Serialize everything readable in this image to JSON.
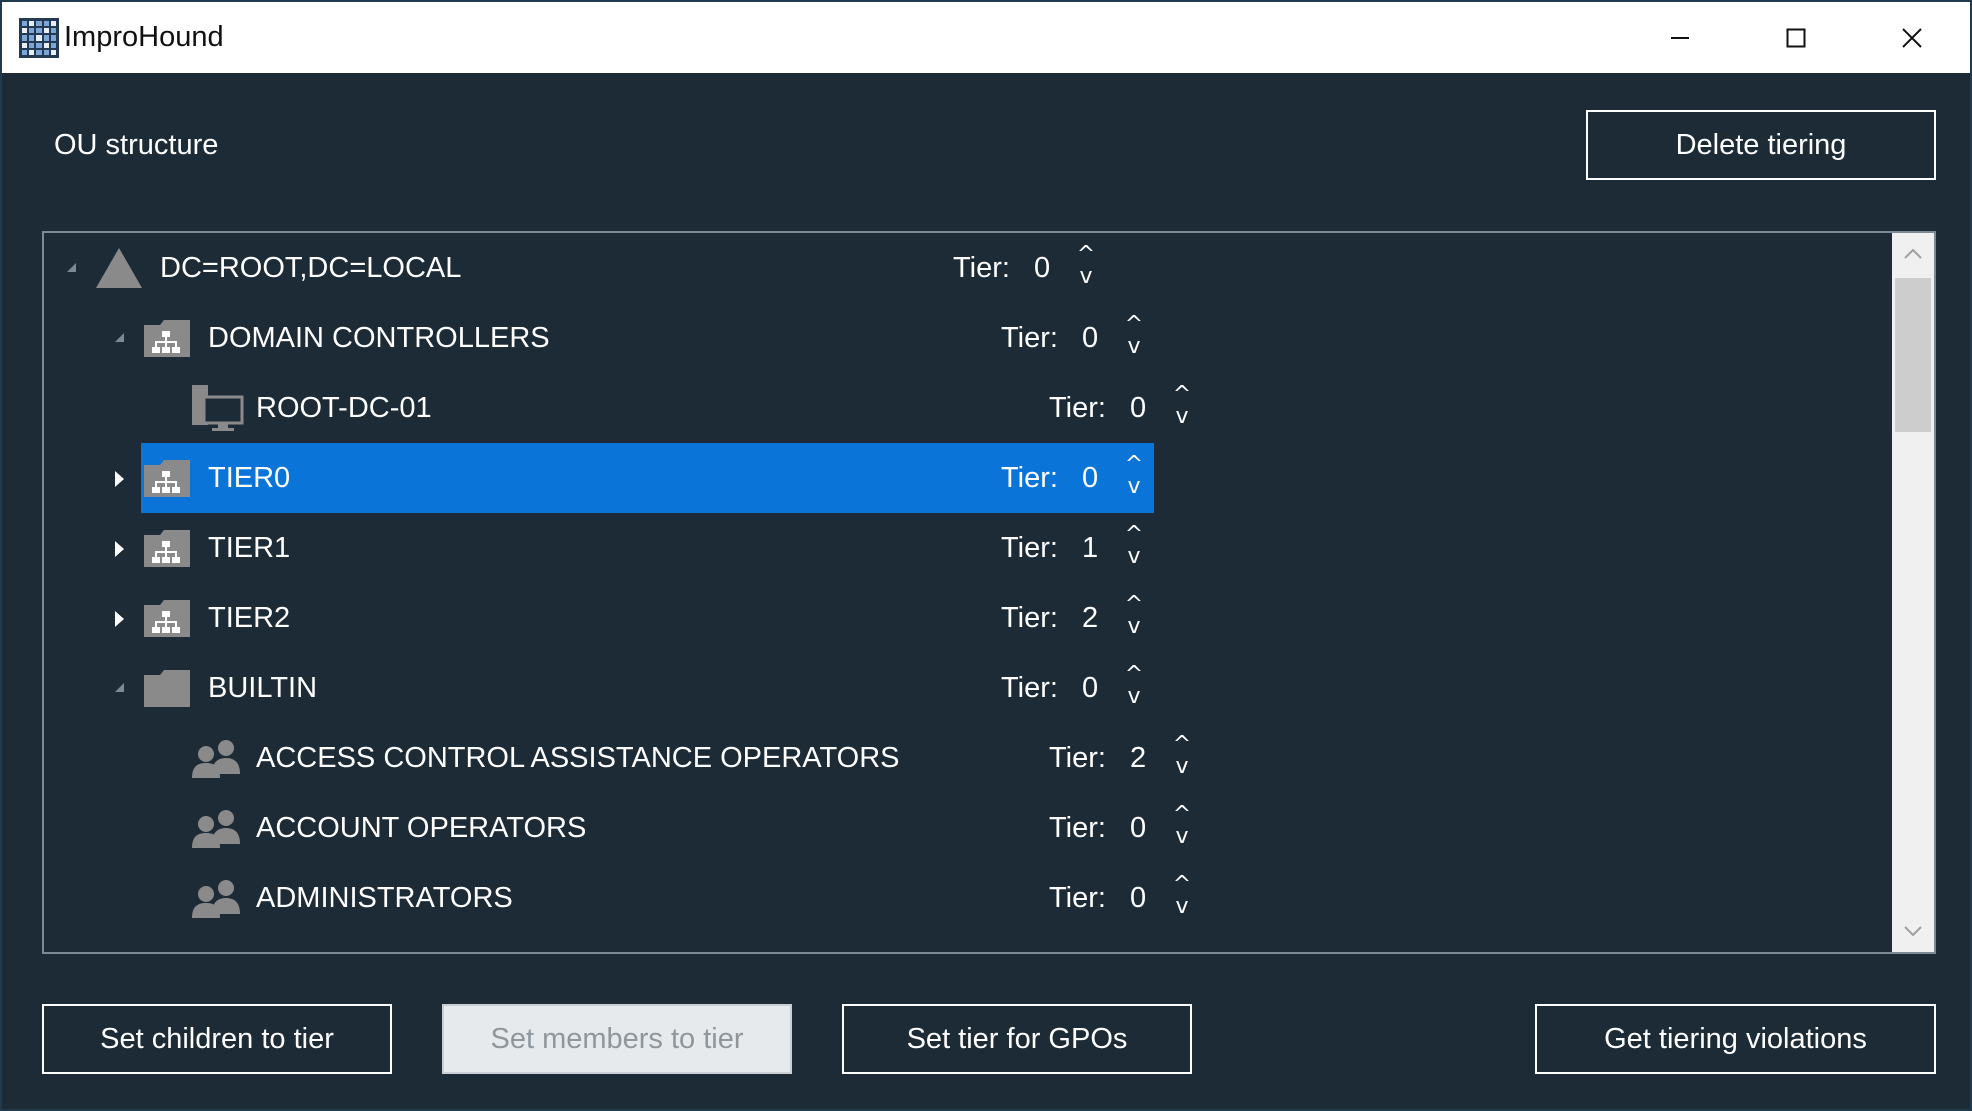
{
  "window": {
    "title": "ImproHound",
    "controls": {
      "minimize": "minimize-icon",
      "maximize": "maximize-icon",
      "close": "close-icon"
    }
  },
  "header": {
    "section_label": "OU structure",
    "delete_button": "Delete tiering"
  },
  "tree": {
    "tier_prefix": "Tier:",
    "rows": [
      {
        "label": "DC=ROOT,DC=LOCAL",
        "icon": "domain-icon",
        "tier": "0",
        "expanded": true,
        "selected": false
      },
      {
        "label": "DOMAIN CONTROLLERS",
        "icon": "ou-icon",
        "tier": "0",
        "expanded": true,
        "selected": false
      },
      {
        "label": "ROOT-DC-01",
        "icon": "computer-icon",
        "tier": "0",
        "expanded": null,
        "selected": false
      },
      {
        "label": "TIER0",
        "icon": "ou-icon",
        "tier": "0",
        "expanded": false,
        "selected": true
      },
      {
        "label": "TIER1",
        "icon": "ou-icon",
        "tier": "1",
        "expanded": false,
        "selected": false
      },
      {
        "label": "TIER2",
        "icon": "ou-icon",
        "tier": "2",
        "expanded": false,
        "selected": false
      },
      {
        "label": "BUILTIN",
        "icon": "folder-icon",
        "tier": "0",
        "expanded": true,
        "selected": false
      },
      {
        "label": "ACCESS CONTROL ASSISTANCE OPERATORS",
        "icon": "group-icon",
        "tier": "2",
        "expanded": null,
        "selected": false
      },
      {
        "label": "ACCOUNT OPERATORS",
        "icon": "group-icon",
        "tier": "0",
        "expanded": null,
        "selected": false
      },
      {
        "label": "ADMINISTRATORS",
        "icon": "group-icon",
        "tier": "0",
        "expanded": null,
        "selected": false
      }
    ],
    "spinner": {
      "up": "^",
      "down": "v"
    }
  },
  "footer": {
    "set_children": "Set children to tier",
    "set_members": "Set members to tier",
    "set_gpos": "Set tier for GPOs",
    "violations": "Get tiering violations"
  },
  "colors": {
    "background": "#1c2b36",
    "selection": "#0a74d9",
    "icon_gray": "#8a8a8a"
  }
}
